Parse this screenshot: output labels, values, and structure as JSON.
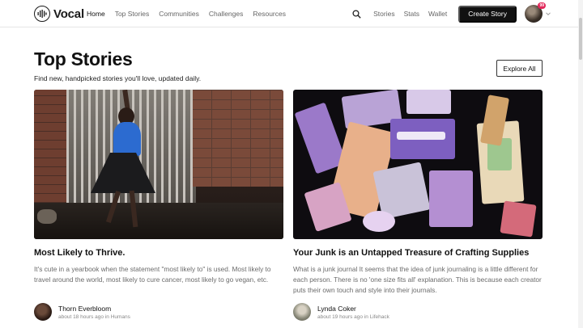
{
  "header": {
    "brand": "Vocal",
    "nav": [
      "Home",
      "Top Stories",
      "Communities",
      "Challenges",
      "Resources"
    ],
    "right_links": [
      "Stories",
      "Stats",
      "Wallet"
    ],
    "create_label": "Create Story",
    "notification_badge": "99",
    "icons": {
      "logo": "vocal-logo-icon",
      "search": "search-icon",
      "chevron": "chevron-down-icon"
    }
  },
  "main": {
    "title": "Top Stories",
    "subtitle": "Find new, handpicked stories you'll love, updated daily.",
    "explore_label": "Explore All",
    "cards": [
      {
        "title": "Most Likely to Thrive.",
        "excerpt": "It's cute in a yearbook when the statement \"most likely to\" is used. Most likely to travel around the world, most likely to cure cancer, most likely to go vegan, etc.",
        "author": "Thorn Everbloom",
        "meta": "about 18 hours ago in Humans"
      },
      {
        "title": "Your Junk is an Untapped Treasure of Crafting Supplies",
        "excerpt": "What is a junk journal It seems that the idea of junk journaling is a little different for each person. There is no 'one size fits all' explanation. This is because each creator puts their own touch and style into their journals.",
        "author": "Lynda Coker",
        "meta": "about 19 hours ago in Lifehack"
      }
    ]
  },
  "colors": {
    "create_button": "#111111",
    "badge": "#e2285a",
    "muted_text": "#6b6b6b"
  }
}
